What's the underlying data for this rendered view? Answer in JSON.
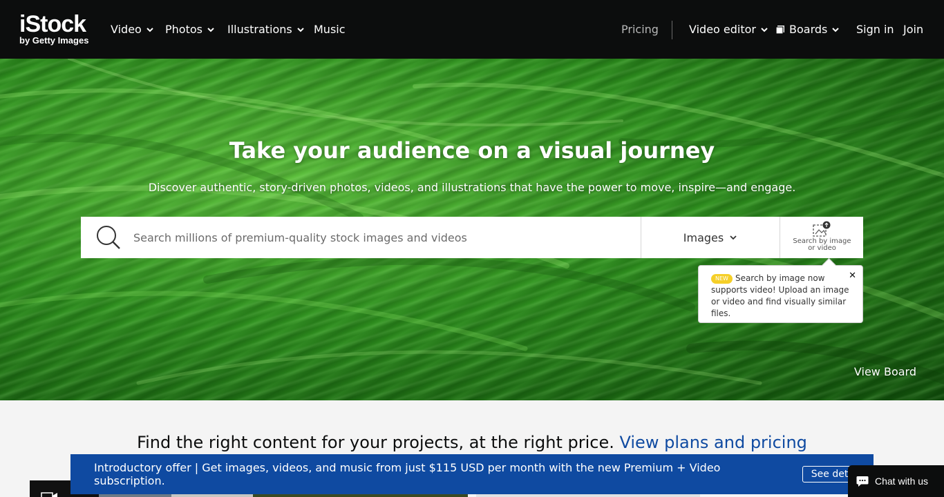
{
  "header": {
    "logo_main": "iStock",
    "logo_sub": "by Getty Images",
    "nav": {
      "video": "Video",
      "photos": "Photos",
      "illustrations": "Illustrations",
      "music": "Music",
      "pricing": "Pricing",
      "video_editor": "Video editor",
      "boards": "Boards",
      "sign_in": "Sign in",
      "join": "Join"
    }
  },
  "hero": {
    "title": "Take your audience on a visual journey",
    "subtitle": "Discover authentic, story-driven photos, videos, and illustrations that have the power to move, inspire—and engage.",
    "search": {
      "placeholder": "Search millions of premium-quality stock images and videos",
      "value": "",
      "type_selected": "Images",
      "image_search_label_1": "Search by image",
      "image_search_label_2": "or video"
    },
    "tooltip": {
      "badge": "NEW",
      "text": "Search by image now supports video! Upload an image or video and find visually similar files.",
      "close": "✕"
    },
    "view_board": "View Board"
  },
  "pricing": {
    "text": "Find the right content for your projects, at the right price.",
    "link": "View plans and pricing"
  },
  "promo": {
    "text": "Introductory offer | Get images, videos, and music from just $115 USD per month with the new Premium + Video subscription.",
    "button": "See details"
  },
  "chat": {
    "label": "Chat with us"
  },
  "colors": {
    "header_bg": "#0c0d0d",
    "brand_blue": "#0f4aa1",
    "badge_yellow": "#f5cf28",
    "page_bg": "#f4f4f4"
  },
  "icons": [
    "chevron-down-icon",
    "boards-icon",
    "search-icon",
    "image-search-icon",
    "close-icon",
    "chat-icon",
    "video-camera-icon"
  ]
}
